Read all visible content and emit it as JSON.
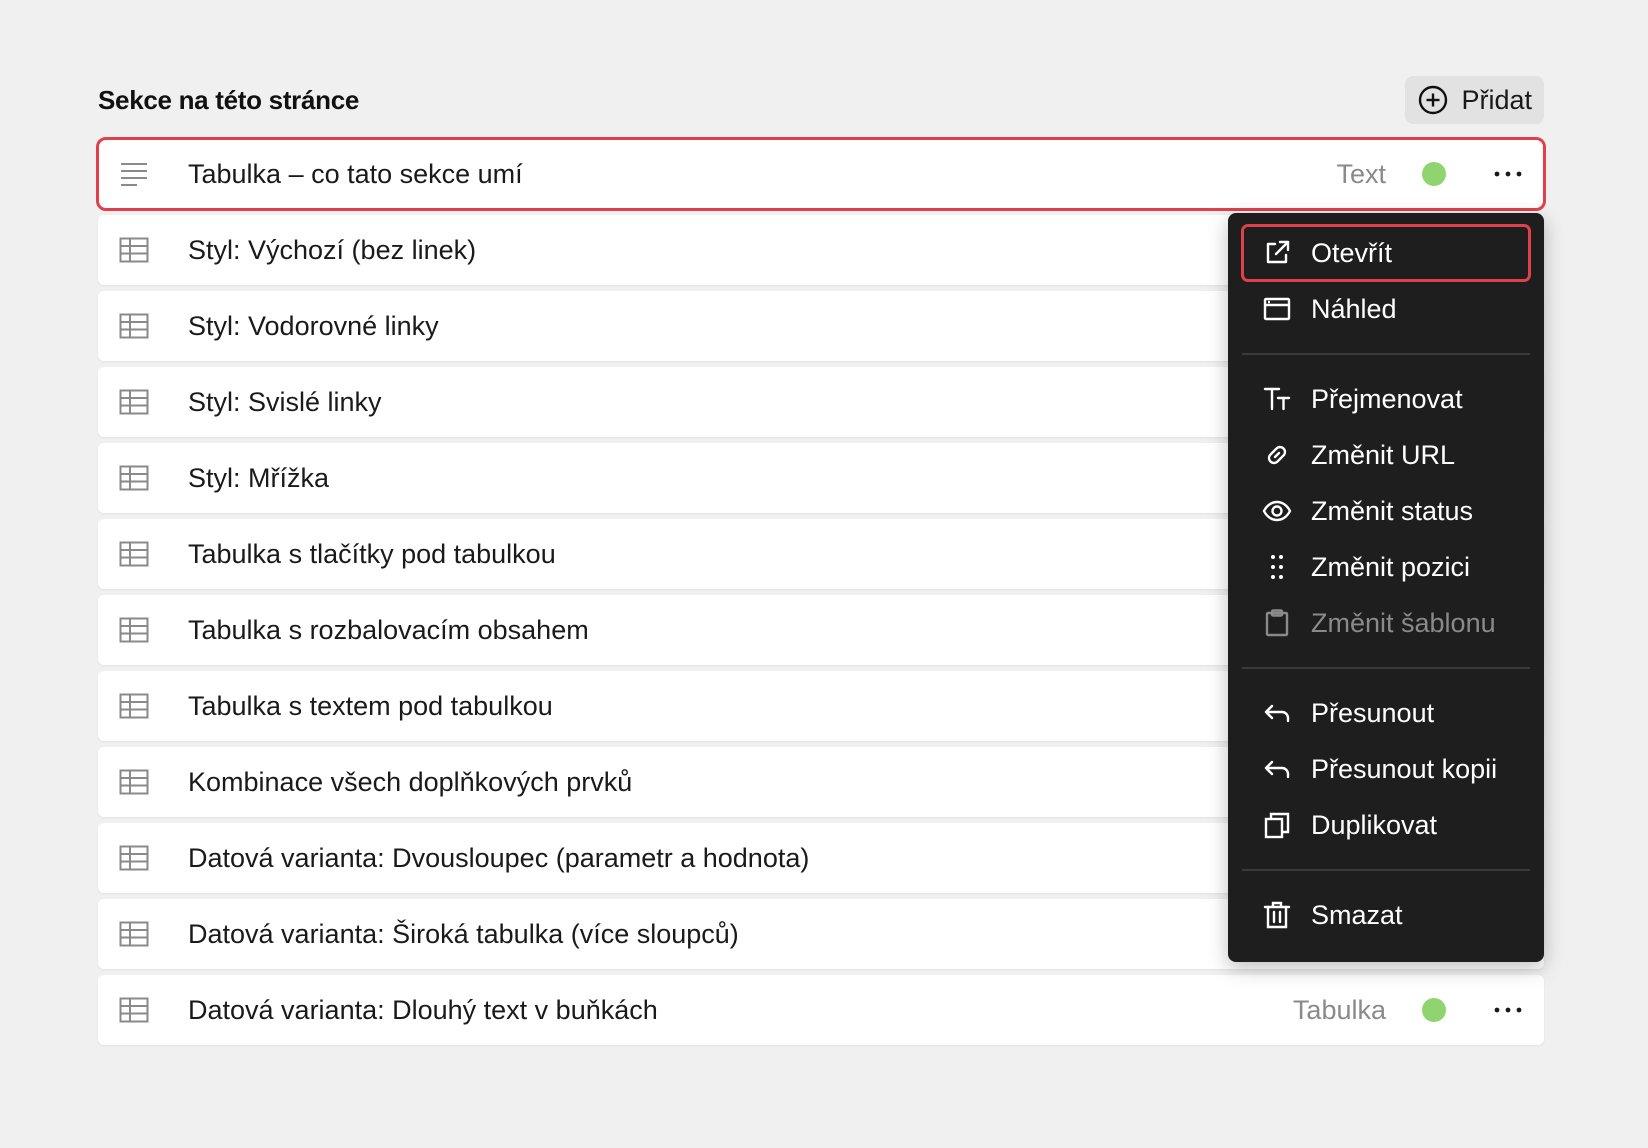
{
  "header": {
    "title": "Sekce na této stránce",
    "add_label": "Přidat"
  },
  "rows": [
    {
      "label": "Tabulka – co tato sekce umí",
      "type": "Text",
      "icon": "text-lines-icon",
      "selected": true,
      "show_meta": true
    },
    {
      "label": "Styl: Výchozí (bez linek)",
      "type": "",
      "icon": "table-icon",
      "show_meta": false
    },
    {
      "label": "Styl: Vodorovné linky",
      "type": "",
      "icon": "table-icon",
      "show_meta": false
    },
    {
      "label": "Styl: Svislé linky",
      "type": "",
      "icon": "table-icon",
      "show_meta": false
    },
    {
      "label": "Styl: Mřížka",
      "type": "",
      "icon": "table-icon",
      "show_meta": false
    },
    {
      "label": "Tabulka s tlačítky pod tabulkou",
      "type": "",
      "icon": "table-icon",
      "show_meta": false
    },
    {
      "label": "Tabulka s rozbalovacím obsahem",
      "type": "",
      "icon": "table-icon",
      "show_meta": false
    },
    {
      "label": "Tabulka s textem pod tabulkou",
      "type": "",
      "icon": "table-icon",
      "show_meta": false
    },
    {
      "label": "Kombinace všech doplňkových prvků",
      "type": "",
      "icon": "table-icon",
      "show_meta": false
    },
    {
      "label": "Datová varianta: Dvousloupec (parametr a hodnota)",
      "type": "",
      "icon": "table-icon",
      "show_meta": false
    },
    {
      "label": "Datová varianta: Široká tabulka (více sloupců)",
      "type": "",
      "icon": "table-icon",
      "show_meta": false
    },
    {
      "label": "Datová varianta: Dlouhý text v buňkách",
      "type": "Tabulka",
      "icon": "table-icon",
      "show_meta": true
    }
  ],
  "menu": {
    "groups": [
      [
        {
          "label": "Otevřít",
          "icon": "external-link-icon",
          "highlight": true
        },
        {
          "label": "Náhled",
          "icon": "preview-window-icon"
        }
      ],
      [
        {
          "label": "Přejmenovat",
          "icon": "text-size-icon"
        },
        {
          "label": "Změnit URL",
          "icon": "link-icon"
        },
        {
          "label": "Změnit status",
          "icon": "eye-icon"
        },
        {
          "label": "Změnit pozici",
          "icon": "drag-handle-icon"
        },
        {
          "label": "Změnit šablonu",
          "icon": "clipboard-icon",
          "disabled": true
        }
      ],
      [
        {
          "label": "Přesunout",
          "icon": "arrow-back-icon"
        },
        {
          "label": "Přesunout kopii",
          "icon": "arrow-back-icon"
        },
        {
          "label": "Duplikovat",
          "icon": "copy-icon"
        }
      ],
      [
        {
          "label": "Smazat",
          "icon": "trash-icon"
        }
      ]
    ]
  },
  "colors": {
    "accent_red": "#e0404c",
    "status_green": "#8fd46e",
    "menu_bg": "#1e1e1e"
  }
}
